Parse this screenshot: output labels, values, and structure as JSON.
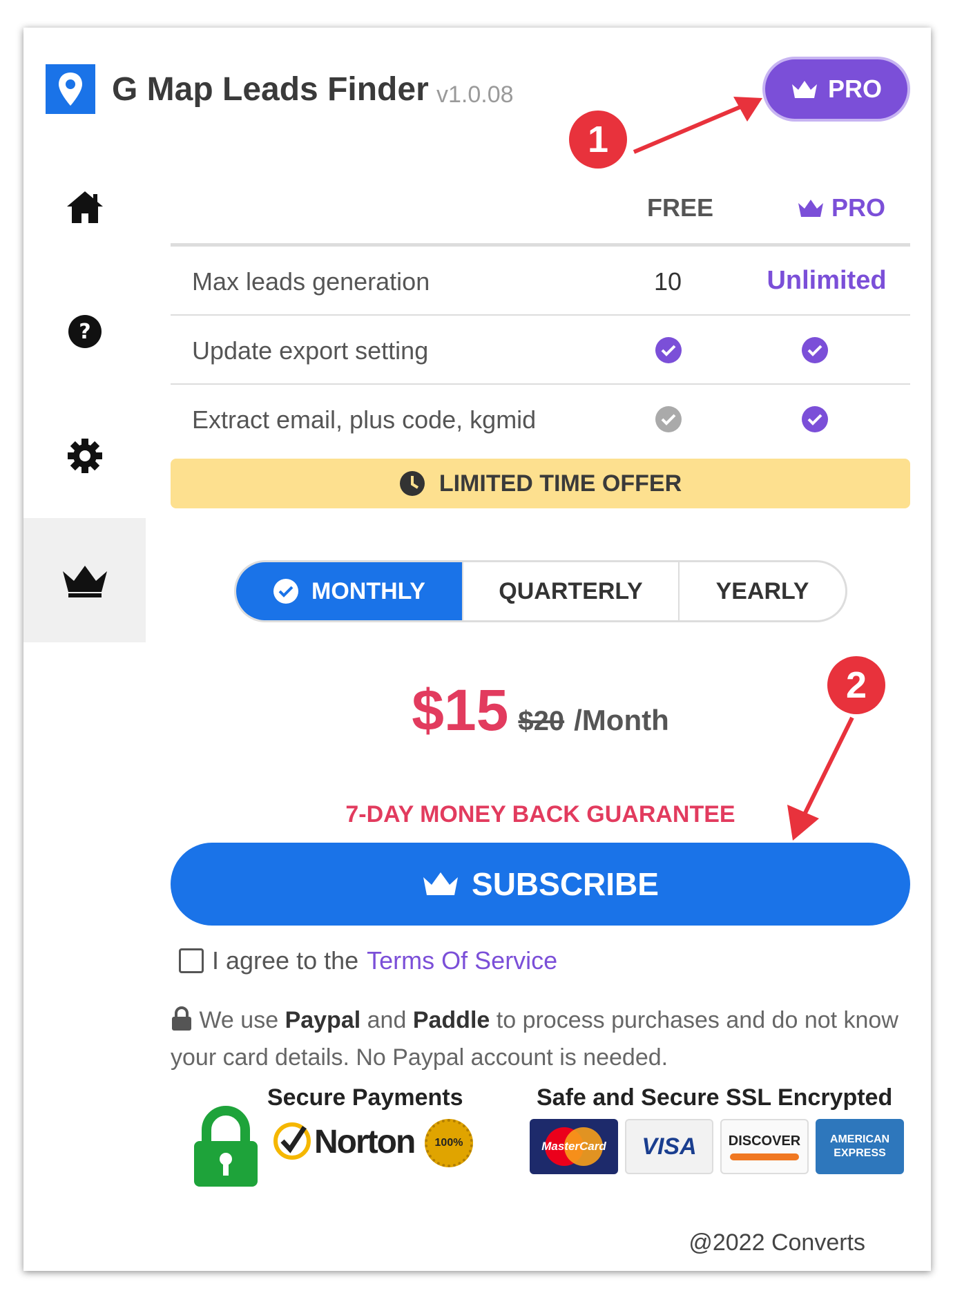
{
  "app": {
    "title": "G Map Leads Finder",
    "version": "v1.0.08"
  },
  "header": {
    "pro_label": "PRO"
  },
  "sidebar": {
    "items": [
      "home",
      "help",
      "settings",
      "pro"
    ]
  },
  "comparison": {
    "col_free": "FREE",
    "col_pro": "PRO",
    "rows": [
      {
        "label": "Max leads generation",
        "free": "10",
        "pro": "Unlimited"
      },
      {
        "label": "Update export setting",
        "free": "included",
        "pro": "included"
      },
      {
        "label": "Extract email, plus code, kgmid",
        "free": "not included",
        "pro": "included"
      }
    ]
  },
  "offer": {
    "label": "LIMITED TIME OFFER"
  },
  "billing": {
    "tabs": [
      "MONTHLY",
      "QUARTERLY",
      "YEARLY"
    ],
    "selected": "MONTHLY"
  },
  "pricing": {
    "price": "$15",
    "old_price": "$20",
    "period": "/Month"
  },
  "guarantee": "7-DAY MONEY BACK GUARANTEE",
  "subscribe_label": "SUBSCRIBE",
  "agree": {
    "prefix": "I agree to the",
    "link": "Terms Of Service",
    "checked": false
  },
  "note": {
    "part1": "We use",
    "paypal": "Paypal",
    "and": "and",
    "paddle": "Paddle",
    "part2": "to process purchases and do not know your card details. No Paypal account is needed."
  },
  "secure": {
    "payments_title": "Secure Payments",
    "ssl_title": "Safe and Secure SSL Encrypted",
    "norton": "Norton",
    "seal": "100%",
    "cards": [
      "MasterCard",
      "VISA",
      "DISCOVER",
      "AMERICAN EXPRESS"
    ]
  },
  "footer": "@2022 Converts",
  "annotations": [
    "1",
    "2"
  ],
  "colors": {
    "accent_purple": "#7b4fd8",
    "primary_blue": "#1a73e8",
    "price_red": "#e23b5e",
    "offer_yellow": "#fde08f"
  }
}
